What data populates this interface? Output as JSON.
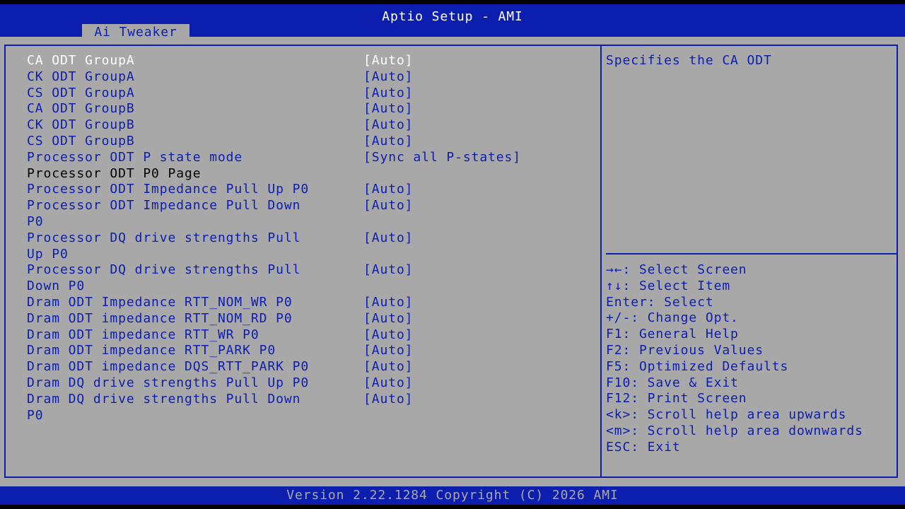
{
  "header": {
    "title": "Aptio Setup - AMI",
    "tabs": [
      {
        "label": "Ai Tweaker",
        "active": true
      }
    ]
  },
  "menu": {
    "items": [
      {
        "label": "CA ODT GroupA",
        "value": "[Auto]",
        "selected": true
      },
      {
        "label": "CK ODT GroupA",
        "value": "[Auto]"
      },
      {
        "label": "CS ODT GroupA",
        "value": "[Auto]"
      },
      {
        "label": "CA ODT GroupB",
        "value": "[Auto]"
      },
      {
        "label": "CK ODT GroupB",
        "value": "[Auto]"
      },
      {
        "label": "CS ODT GroupB",
        "value": "[Auto]"
      },
      {
        "label": "Processor ODT P state mode",
        "value": "[Sync all P-states]"
      },
      {
        "label": "Processor ODT P0 Page",
        "value": "",
        "static": true
      },
      {
        "label": "Processor ODT Impedance Pull Up P0",
        "value": "[Auto]"
      },
      {
        "label": "Processor ODT Impedance Pull Down\nP0",
        "value": "[Auto]"
      },
      {
        "label": "Processor DQ drive strengths Pull\nUp P0",
        "value": "[Auto]"
      },
      {
        "label": "Processor DQ drive strengths Pull\nDown P0",
        "value": "[Auto]"
      },
      {
        "label": "Dram ODT Impedance RTT_NOM_WR P0",
        "value": "[Auto]"
      },
      {
        "label": "Dram ODT impedance RTT_NOM_RD P0",
        "value": "[Auto]"
      },
      {
        "label": "Dram ODT impedance RTT_WR P0",
        "value": "[Auto]"
      },
      {
        "label": "Dram ODT impedance RTT_PARK P0",
        "value": "[Auto]"
      },
      {
        "label": "Dram ODT impedance DQS_RTT_PARK P0",
        "value": "[Auto]"
      },
      {
        "label": "Dram DQ drive strengths Pull Up P0",
        "value": "[Auto]"
      },
      {
        "label": "Dram DQ drive strengths Pull Down\nP0",
        "value": "[Auto]"
      }
    ]
  },
  "help": {
    "text": "Specifies the CA ODT"
  },
  "key_hints": [
    "→←: Select Screen",
    "↑↓: Select Item",
    "Enter: Select",
    "+/-: Change Opt.",
    "F1: General Help",
    "F2: Previous Values",
    "F5: Optimized Defaults",
    "F10: Save & Exit",
    "F12: Print Screen",
    "<k>: Scroll help area upwards",
    "<m>: Scroll help area downwards",
    "ESC: Exit"
  ],
  "footer": {
    "text": "Version 2.22.1284 Copyright (C) 2026 AMI"
  },
  "colors": {
    "blue": "#0c1eae",
    "panel_gray": "#a8a8a8",
    "selected_text": "#ffffff",
    "static_text": "#000000"
  }
}
